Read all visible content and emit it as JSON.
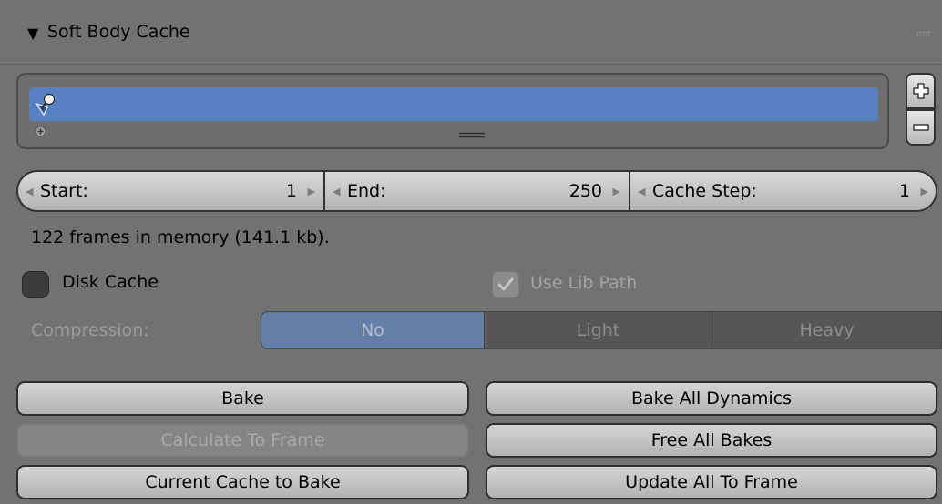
{
  "panel": {
    "title": "Soft Body Cache",
    "collapse_icon": "triangle-down-icon",
    "drag_icon": "grip-icon"
  },
  "cache_list": {
    "rows": [
      {
        "name": "",
        "icon": "pin-icon",
        "selected": true
      }
    ],
    "add_button_icon": "plus-icon",
    "remove_button_icon": "minus-icon",
    "resize_icon": "resize-handle-icon"
  },
  "frame_range": {
    "start_label": "Start:",
    "start_value": "1",
    "end_label": "End:",
    "end_value": "250",
    "step_label": "Cache Step:",
    "step_value": "1"
  },
  "info": "122 frames in memory (141.1 kb).",
  "disk_cache": {
    "label": "Disk Cache",
    "checked": false
  },
  "lib_path": {
    "label": "Use Lib Path",
    "checked": true,
    "enabled": false
  },
  "compression": {
    "label": "Compression:",
    "options": [
      "No",
      "Light",
      "Heavy"
    ],
    "selected": "No"
  },
  "buttons": {
    "bake": "Bake",
    "bake_all": "Bake All Dynamics",
    "calculate": "Calculate To Frame",
    "free_all": "Free All Bakes",
    "current_to_bake": "Current Cache to Bake",
    "update_all": "Update All To Frame"
  },
  "colors": {
    "panel_bg": "#727272",
    "selection": "#5680c2",
    "compression_selected": "#637ea7"
  }
}
